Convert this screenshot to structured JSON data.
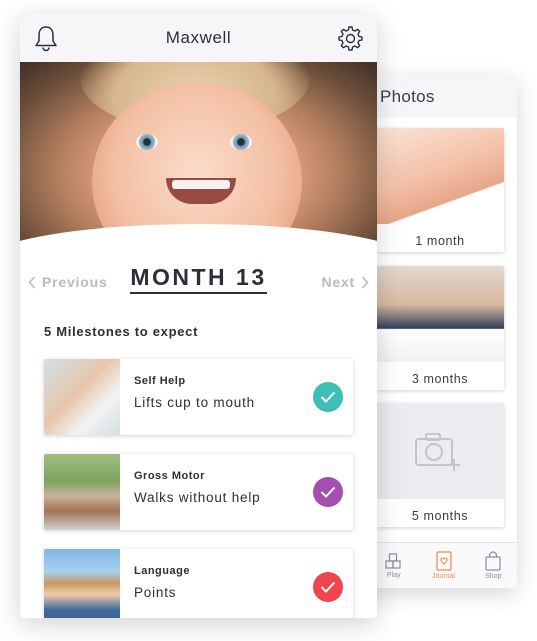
{
  "front": {
    "header": {
      "name": "Maxwell"
    },
    "month": {
      "title": "MONTH 13",
      "prev_label": "Previous",
      "next_label": "Next"
    },
    "milestones_heading": "5 Milestones to expect",
    "milestones": [
      {
        "category": "Self Help",
        "text": "Lifts cup to mouth",
        "check_color": "#3dbfb5"
      },
      {
        "category": "Gross Motor",
        "text": "Walks without help",
        "check_color": "#a44fb0"
      },
      {
        "category": "Language",
        "text": "Points",
        "check_color": "#f0454f"
      }
    ]
  },
  "back": {
    "header": {
      "title": "Photos"
    },
    "photos": [
      {
        "label": "1 month"
      },
      {
        "label": "3 months"
      },
      {
        "label": "5 months"
      }
    ],
    "tabs": [
      {
        "label": "Play",
        "icon": "blocks-icon"
      },
      {
        "label": "Journal",
        "icon": "journal-icon",
        "active": true
      },
      {
        "label": "Shop",
        "icon": "bag-icon"
      }
    ]
  },
  "colors": {
    "accent": "#f08a4b"
  }
}
